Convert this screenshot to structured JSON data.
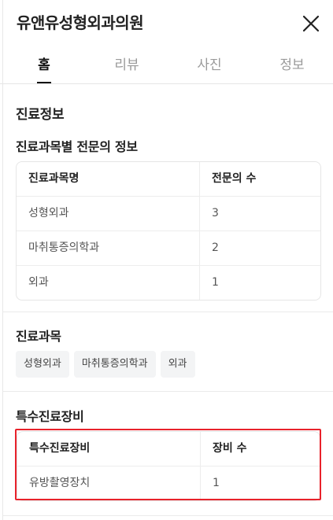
{
  "header": {
    "title": "유앤유성형외과의원"
  },
  "tabs": [
    {
      "label": "홈"
    },
    {
      "label": "리뷰"
    },
    {
      "label": "사진"
    },
    {
      "label": "정보"
    }
  ],
  "info": {
    "title": "진료정보",
    "specialists": {
      "title": "진료과목별 전문의 정보",
      "headers": [
        "진료과목명",
        "전문의 수"
      ],
      "rows": [
        [
          "성형외과",
          "3"
        ],
        [
          "마취통증의학과",
          "2"
        ],
        [
          "외과",
          "1"
        ]
      ]
    },
    "departments": {
      "title": "진료과목",
      "tags": [
        "성형외과",
        "마취통증의학과",
        "외과"
      ]
    },
    "equipment": {
      "title": "특수진료장비",
      "headers": [
        "특수진료장비",
        "장비 수"
      ],
      "rows": [
        [
          "유방촬영장치",
          "1"
        ]
      ]
    }
  },
  "colors": {
    "highlight": "#e8222b",
    "tag_bg": "#f3f4f5"
  }
}
